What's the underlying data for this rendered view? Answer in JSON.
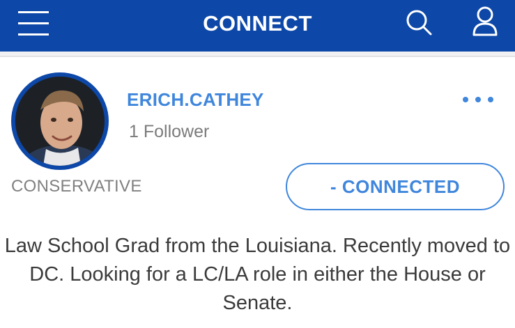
{
  "header": {
    "title": "CONNECT",
    "background_color": "#0d48a8"
  },
  "icons": {
    "menu": "hamburger-menu-icon",
    "search": "search-icon",
    "profile": "user-profile-icon",
    "more": "more-options-icon"
  },
  "profile": {
    "username": "ERICH.CATHEY",
    "followers": "1 Follower",
    "party": "CONSERVATIVE",
    "connect_label": "- CONNECTED",
    "bio": "Law School Grad from the Louisiana. Recently moved to DC. Looking for a LC/LA role in either the House or Senate.",
    "accent_color": "#3f86dc"
  }
}
